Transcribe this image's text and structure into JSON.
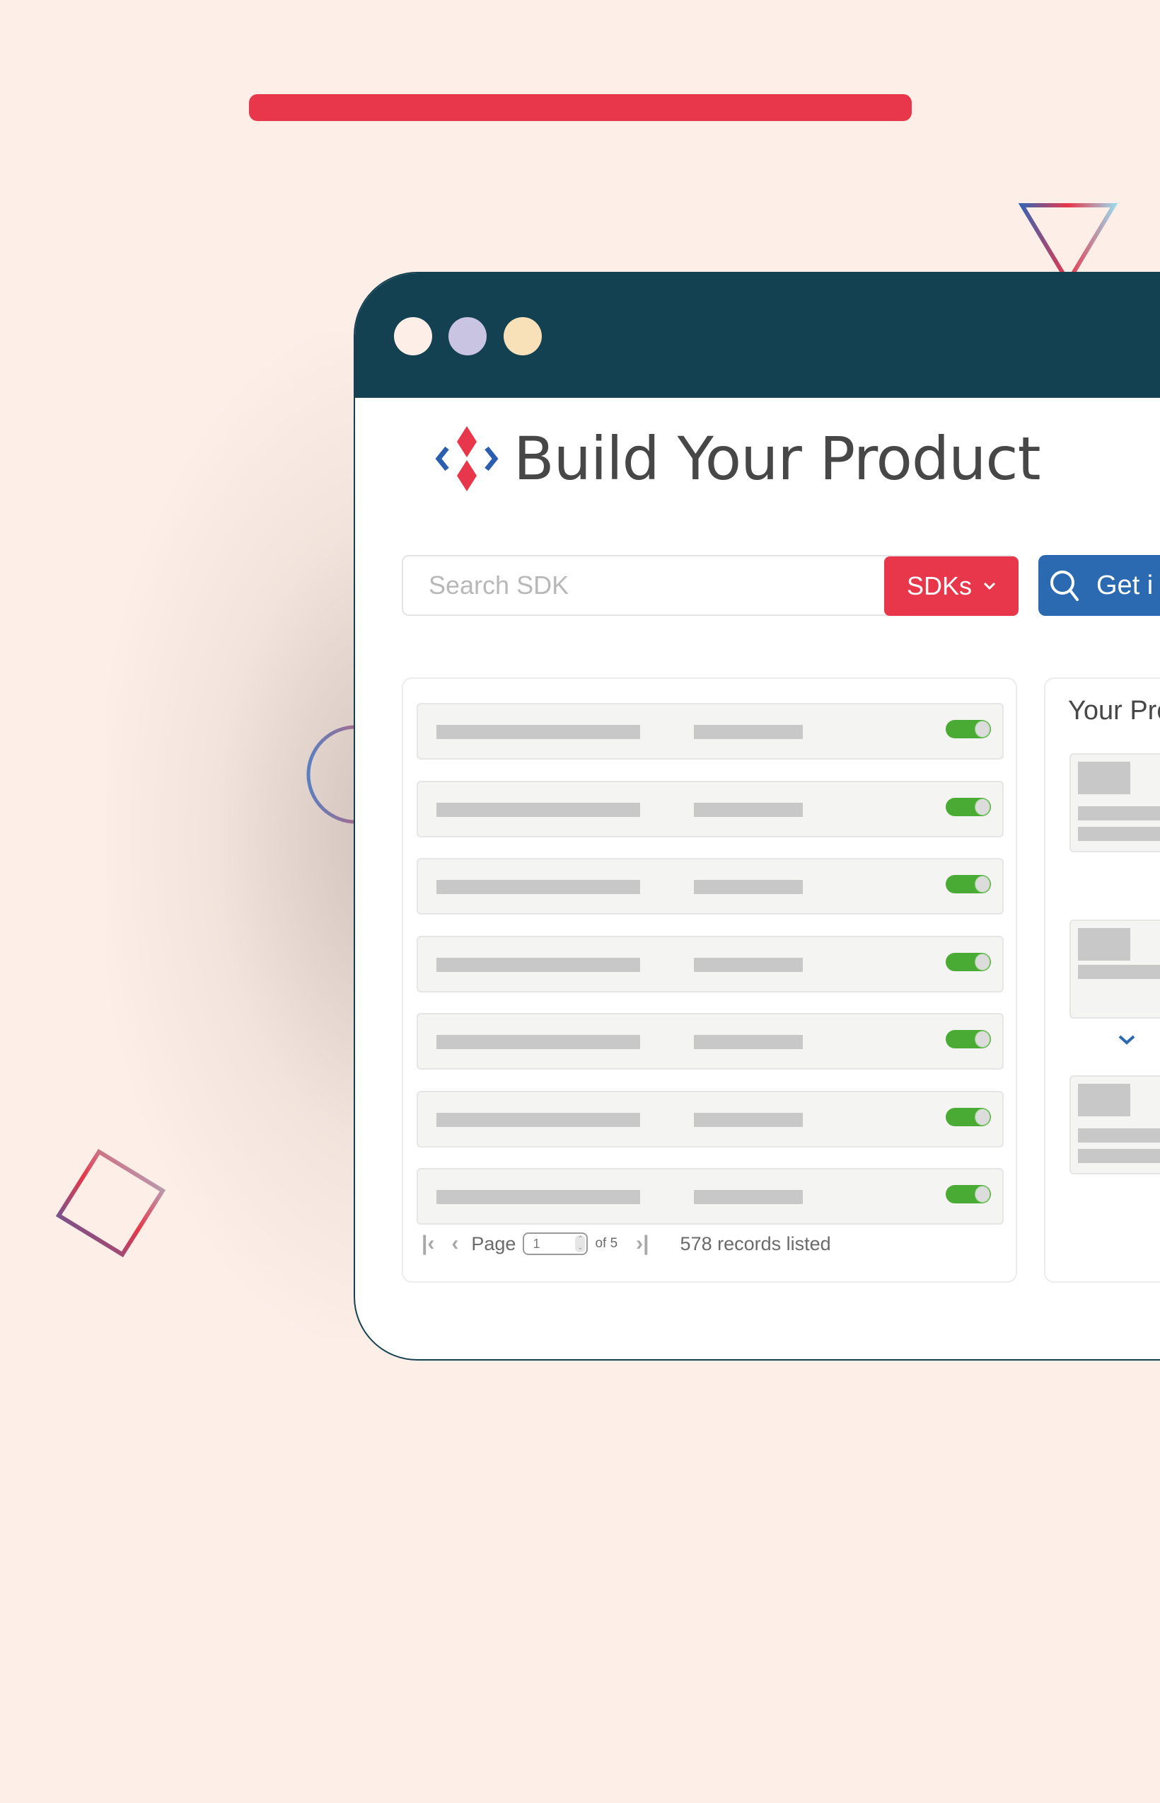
{
  "header": {
    "title": "Build Your Product"
  },
  "window": {
    "traffic_lights": [
      "#fdefe8",
      "#c8c4e2",
      "#f8e0b8"
    ],
    "titlebar_color": "#134152"
  },
  "search": {
    "placeholder": "Search SDK",
    "value": "",
    "filter_label": "SDKs",
    "action_label": "Get i"
  },
  "list": {
    "rows": [
      {
        "enabled": true
      },
      {
        "enabled": true
      },
      {
        "enabled": true
      },
      {
        "enabled": true
      },
      {
        "enabled": true
      },
      {
        "enabled": true
      },
      {
        "enabled": true
      }
    ],
    "pagination": {
      "label": "Page",
      "current_page": "1",
      "of_label": "of 5",
      "records": "578 records listed"
    }
  },
  "products_panel": {
    "title": "Your Pro"
  },
  "colors": {
    "background": "#fdefe8",
    "accent_red": "#e8374a",
    "accent_blue": "#2b69b1",
    "toggle_on": "#4aab34"
  }
}
